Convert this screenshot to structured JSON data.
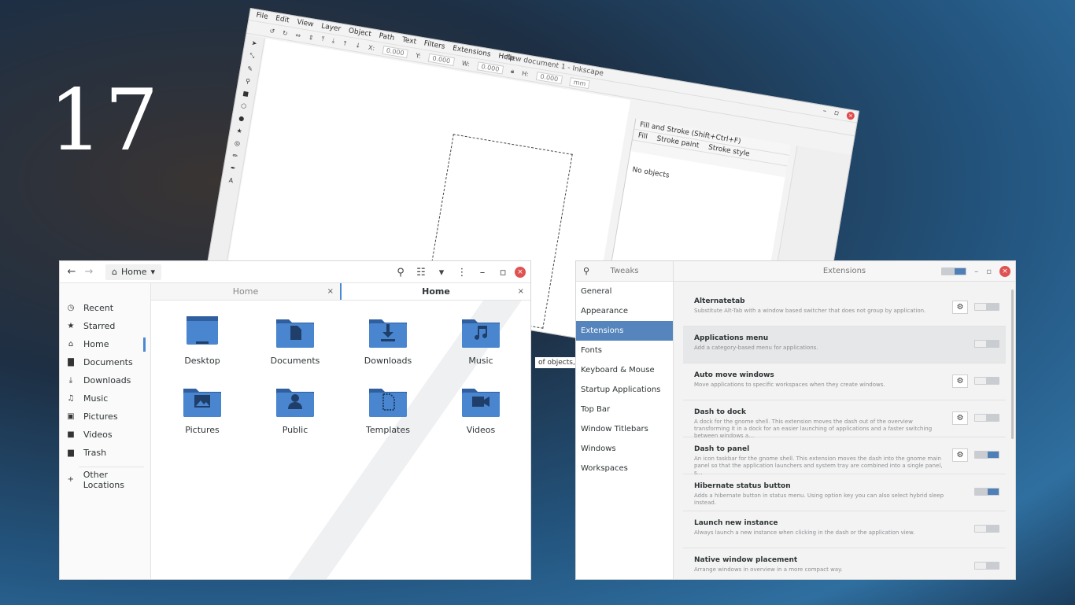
{
  "overlay": {
    "number": "17"
  },
  "inkscape": {
    "title": "New document 1 - Inkscape",
    "menu": [
      "File",
      "Edit",
      "View",
      "Layer",
      "Object",
      "Path",
      "Text",
      "Filters",
      "Extensions",
      "Help"
    ],
    "toolbar_fields": [
      "0.000",
      "0.000",
      "0.000",
      "0.000"
    ],
    "unit": "mm",
    "panel": {
      "title": "Fill and Stroke (Shift+Ctrl+F)",
      "tabs": [
        "Fill",
        "Stroke paint",
        "Stroke style"
      ],
      "status": "No objects"
    },
    "statusbar": "of objects, or"
  },
  "files": {
    "path_label": "Home",
    "tabs": [
      {
        "label": "Home",
        "active": false
      },
      {
        "label": "Home",
        "active": true
      }
    ],
    "sidebar": [
      {
        "label": "Recent",
        "icon": "clock-icon",
        "glyph": "◷"
      },
      {
        "label": "Starred",
        "icon": "star-icon",
        "glyph": "★"
      },
      {
        "label": "Home",
        "icon": "home-icon",
        "glyph": "⌂",
        "active": true
      },
      {
        "label": "Documents",
        "icon": "document-icon",
        "glyph": "▇"
      },
      {
        "label": "Downloads",
        "icon": "download-icon",
        "glyph": "⤓"
      },
      {
        "label": "Music",
        "icon": "music-icon",
        "glyph": "♫"
      },
      {
        "label": "Pictures",
        "icon": "picture-icon",
        "glyph": "▣"
      },
      {
        "label": "Videos",
        "icon": "video-icon",
        "glyph": "■"
      },
      {
        "label": "Trash",
        "icon": "trash-icon",
        "glyph": "▆"
      }
    ],
    "other_locations": "Other Locations",
    "folders": [
      {
        "label": "Desktop",
        "icon": "desktop-folder-icon",
        "glyph": "desktop"
      },
      {
        "label": "Documents",
        "icon": "documents-folder-icon",
        "glyph": "doc"
      },
      {
        "label": "Downloads",
        "icon": "downloads-folder-icon",
        "glyph": "down"
      },
      {
        "label": "Music",
        "icon": "music-folder-icon",
        "glyph": "music"
      },
      {
        "label": "Pictures",
        "icon": "pictures-folder-icon",
        "glyph": "pic"
      },
      {
        "label": "Public",
        "icon": "public-folder-icon",
        "glyph": "user"
      },
      {
        "label": "Templates",
        "icon": "templates-folder-icon",
        "glyph": "tmpl"
      },
      {
        "label": "Videos",
        "icon": "videos-folder-icon",
        "glyph": "video"
      }
    ],
    "colors": {
      "folder": "#4a86cf",
      "folder_dark": "#2f5f9f",
      "accent": "#4a88d0"
    }
  },
  "tweaks": {
    "left_title": "Tweaks",
    "right_title": "Extensions",
    "sidebar": [
      {
        "label": "General"
      },
      {
        "label": "Appearance"
      },
      {
        "label": "Extensions",
        "active": true
      },
      {
        "label": "Fonts"
      },
      {
        "label": "Keyboard & Mouse"
      },
      {
        "label": "Startup Applications"
      },
      {
        "label": "Top Bar"
      },
      {
        "label": "Window Titlebars"
      },
      {
        "label": "Windows"
      },
      {
        "label": "Workspaces"
      }
    ],
    "extensions": [
      {
        "name": "Alternatetab",
        "desc": "Substitute Alt-Tab with a window based switcher that does not group by application.",
        "gear": true,
        "on": false,
        "selected": false
      },
      {
        "name": "Applications menu",
        "desc": "Add a category-based menu for applications.",
        "gear": false,
        "on": false,
        "selected": true
      },
      {
        "name": "Auto move windows",
        "desc": "Move applications to specific workspaces when they create windows.",
        "gear": true,
        "on": false,
        "selected": false
      },
      {
        "name": "Dash to dock",
        "desc": "A dock for the gnome shell. This extension moves the dash out of the overview transforming it in a dock for an easier launching of applications and a faster switching between windows a…",
        "gear": true,
        "on": false,
        "selected": false
      },
      {
        "name": "Dash to panel",
        "desc": "An icon taskbar for the gnome shell. This extension moves the dash into the gnome main panel so that the application launchers and system tray are combined into a single panel, s…",
        "gear": true,
        "on": true,
        "selected": false
      },
      {
        "name": "Hibernate status button",
        "desc": "Adds a hibernate button in status menu. Using option key you can also select hybrid sleep instead.",
        "gear": false,
        "on": true,
        "selected": false
      },
      {
        "name": "Launch new instance",
        "desc": "Always launch a new instance when clicking in the dash or the application view.",
        "gear": false,
        "on": false,
        "selected": false
      },
      {
        "name": "Native window placement",
        "desc": "Arrange windows in overview in a more compact way.",
        "gear": false,
        "on": false,
        "selected": false
      }
    ],
    "colors": {
      "active": "#5685bd",
      "switch_on": "#4f7fb7"
    }
  }
}
